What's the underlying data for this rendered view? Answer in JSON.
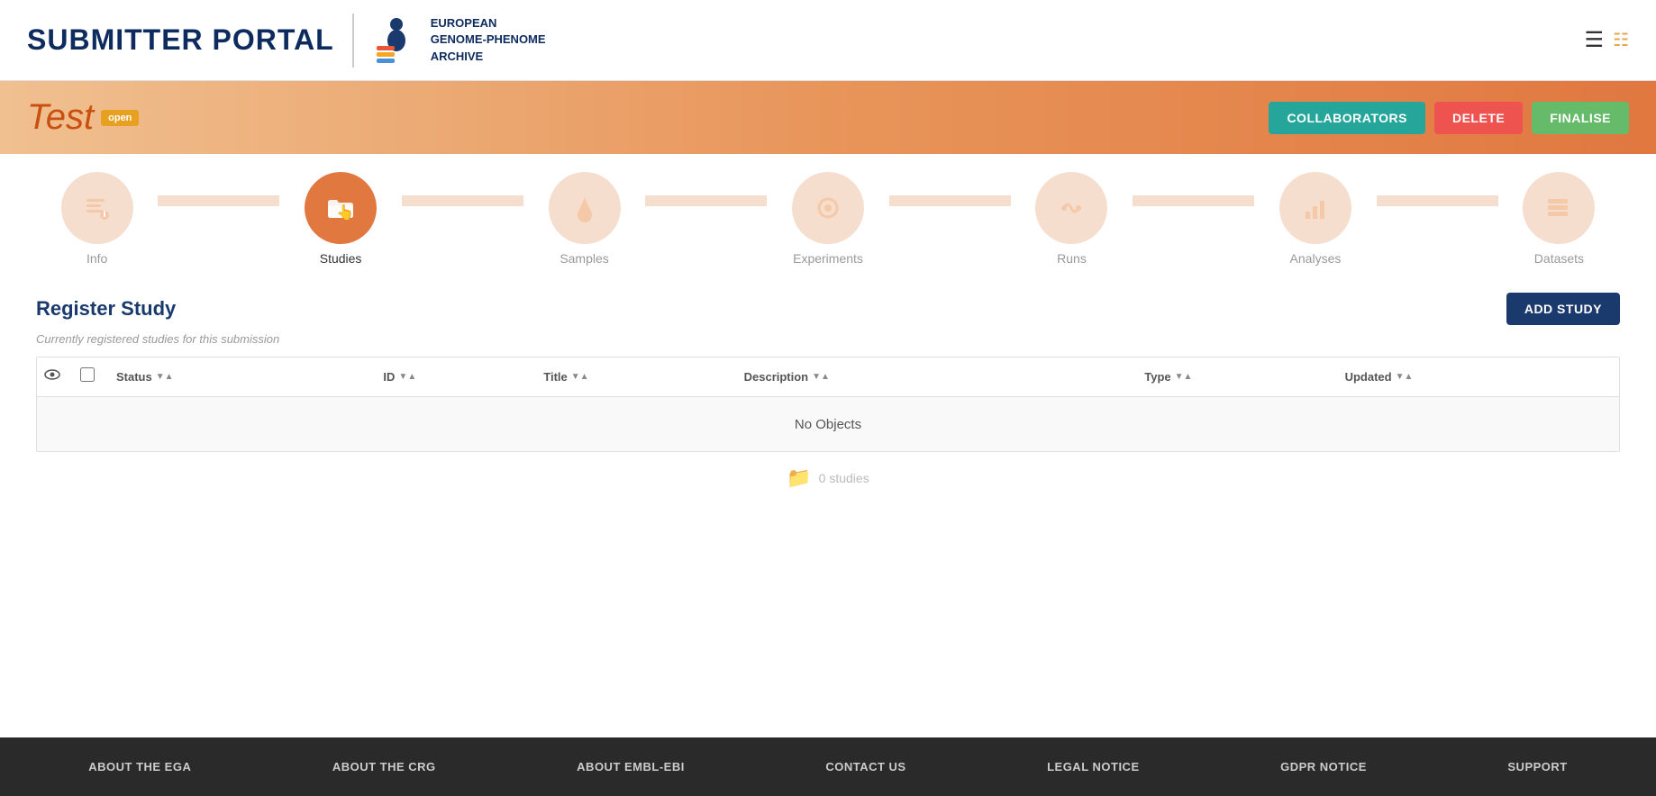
{
  "header": {
    "portal_title": "SUBMITTER PORTAL",
    "logo_text_line1": "EUROPEAN",
    "logo_text_line2": "GENOME-PHENOME",
    "logo_text_line3": "ARCHIVE"
  },
  "banner": {
    "submission_name": "Test",
    "status_badge": "open",
    "btn_collaborators": "COLLABORATORS",
    "btn_delete": "DELETE",
    "btn_finalise": "FINALISE"
  },
  "steps": [
    {
      "id": "info",
      "label": "Info",
      "icon": "✏️",
      "active": false
    },
    {
      "id": "studies",
      "label": "Studies",
      "icon": "📁",
      "active": true
    },
    {
      "id": "samples",
      "label": "Samples",
      "icon": "💧",
      "active": false
    },
    {
      "id": "experiments",
      "label": "Experiments",
      "icon": "🔬",
      "active": false
    },
    {
      "id": "runs",
      "label": "Runs",
      "icon": "🔗",
      "active": false
    },
    {
      "id": "analyses",
      "label": "Analyses",
      "icon": "📊",
      "active": false
    },
    {
      "id": "datasets",
      "label": "Datasets",
      "icon": "📋",
      "active": false
    }
  ],
  "register_study": {
    "title": "Register Study",
    "subtitle": "Currently registered studies for this submission",
    "btn_add": "ADD STUDY",
    "table": {
      "columns": [
        "Status",
        "ID",
        "Title",
        "Description",
        "Type",
        "Updated"
      ],
      "empty_message": "No Objects",
      "empty_count": "0 studies"
    }
  },
  "footer": {
    "links": [
      "ABOUT THE EGA",
      "ABOUT THE CRG",
      "ABOUT EMBL-EBI",
      "CONTACT US",
      "LEGAL NOTICE",
      "GDPR NOTICE",
      "SUPPORT"
    ]
  }
}
